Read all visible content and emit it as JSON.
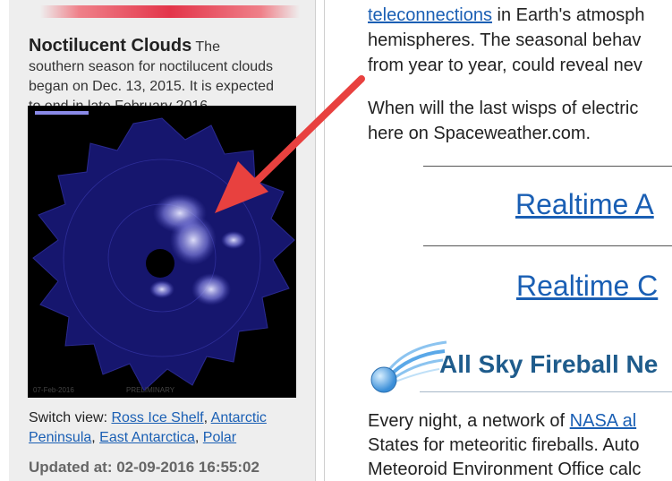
{
  "sidebar": {
    "nlc_title": "Noctilucent Clouds",
    "nlc_text_1": " The",
    "nlc_text_2": "southern season for noctilucent clouds",
    "nlc_text_3": "began on Dec. 13, 2015. It is expected",
    "nlc_text_4": "to end in late February 2016.",
    "image_date": "07-Feb-2016",
    "image_status": "PRELIMINARY",
    "switch_view_label": "Switch view: ",
    "views": [
      "Ross Ice Shelf",
      "Antarctic",
      "Peninsula",
      "East Antarctica",
      "Polar"
    ],
    "updated_label": "Updated at: 02-09-2016 16:55:02"
  },
  "main": {
    "p1_link": "teleconnections",
    "p1_line1_rest": " in Earth's atmosph",
    "p1_line2": "hemispheres. The seasonal behav",
    "p1_line3": "from year to year, could reveal nev",
    "p2_line1": "When will the last wisps of electric",
    "p2_line2": "here on Spaceweather.com.",
    "realtime_link_1": "Realtime A",
    "realtime_link_2": "Realtime C",
    "fireball_title": "All Sky Fireball Ne",
    "p3_line1_prefix": "Every night, a network of ",
    "p3_line1_link": "NASA al",
    "p3_line2": "States for meteoritic fireballs. Auto",
    "p3_line3": "Meteoroid Environment Office calc"
  },
  "colors": {
    "link": "#1a5fb4",
    "arrow": "#e8413f",
    "fireball_title": "#1f5c8c",
    "sidebar_bg": "#eeeeee",
    "sky_blue": "#16166e"
  },
  "icons": {
    "fireball": "fireball-icon",
    "arrow": "red-arrow-annotation"
  }
}
